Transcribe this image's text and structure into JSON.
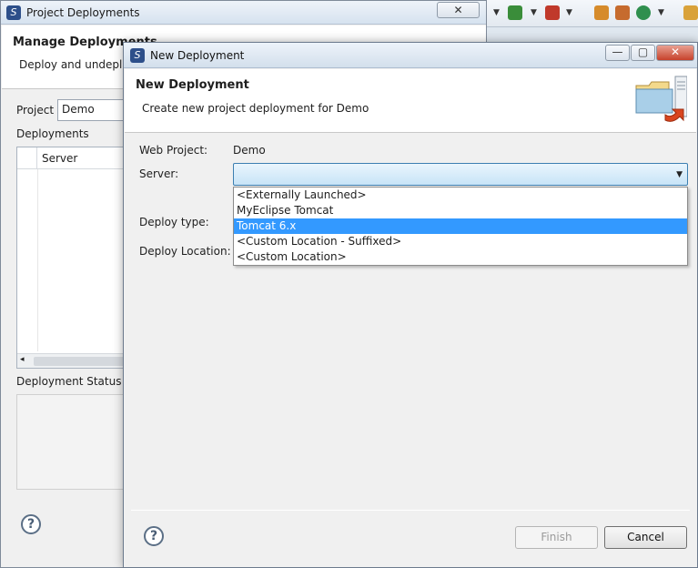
{
  "back_window": {
    "title": "Project Deployments",
    "close_label": "✕",
    "header_title": "Manage Deployments",
    "header_subtitle": "Deploy and undeplo",
    "project_label": "Project",
    "project_value": "Demo",
    "deployments_label": "Deployments",
    "table_header_server": "Server",
    "scroll_left": "◂",
    "status_label": "Deployment Status",
    "help_label": "?"
  },
  "dialog": {
    "title": "New Deployment",
    "minimize_label": "—",
    "maximize_label": "▢",
    "close_label": "✕",
    "header_title": "New Deployment",
    "header_subtitle": "Create new project deployment for Demo",
    "web_project_label": "Web Project:",
    "web_project_value": "Demo",
    "server_label": "Server:",
    "server_value": "",
    "deploy_type_label": "Deploy type:",
    "deploy_location_label": "Deploy Location:",
    "server_options": [
      "<Externally Launched>",
      "MyEclipse Tomcat",
      "Tomcat  6.x",
      "<Custom Location - Suffixed>",
      "<Custom Location>"
    ],
    "selected_index": 2,
    "help_label": "?",
    "finish_label": "Finish",
    "cancel_label": "Cancel"
  },
  "colors": {
    "selection": "#3399ff",
    "combo_border": "#3c7fb1"
  }
}
